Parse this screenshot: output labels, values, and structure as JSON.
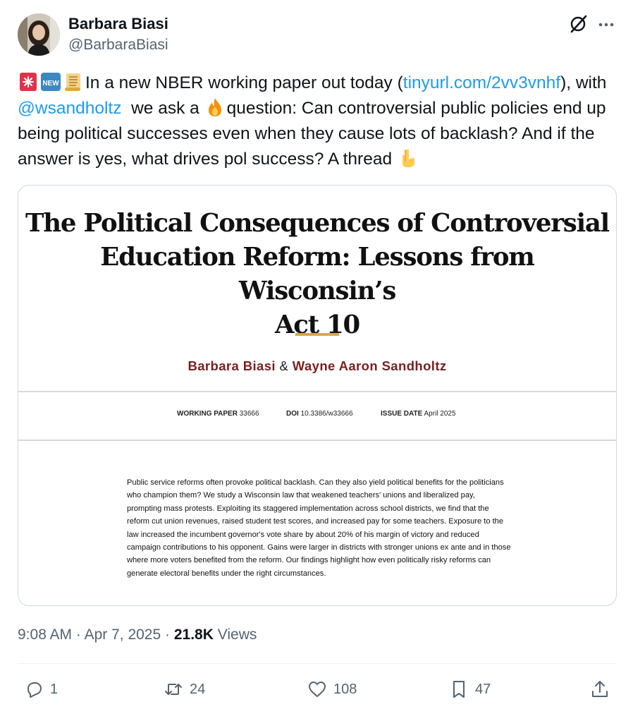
{
  "author": {
    "name": "Barbara Biasi",
    "handle": "@BarbaraBiasi"
  },
  "tweet": {
    "emojis": [
      "siren-emoji",
      "new-emoji",
      "scroll-emoji",
      "fire-emoji",
      "pointing-down-emoji"
    ],
    "part1": "In a new NBER working paper out today (",
    "link": "tinyurl.com/2vv3vnhf",
    "part2": "), with ",
    "mention": "@wsandholtz",
    "part3": "  we ask a ",
    "part4": "question: Can controversial public policies end up being political successes even when they cause lots of backlash? And if the answer is yes, what drives pol success? A thread "
  },
  "paper": {
    "title_line1": "The Political Consequences of Controversial",
    "title_line2": "Education Reform: Lessons from Wisconsin’s",
    "title_line3": "Act 10",
    "author1": "Barbara Biasi",
    "amp": "&",
    "author2": "Wayne Aaron Sandholtz",
    "wp_label": "WORKING PAPER",
    "wp_value": "33666",
    "doi_label": "DOI",
    "doi_value": "10.3386/w33666",
    "date_label": "ISSUE DATE",
    "date_value": "April 2025",
    "abstract": "Public service reforms often provoke political backlash. Can they also yield political benefits for the politicians who champion them? We study a Wisconsin law that weakened teachers' unions and liberalized pay, prompting mass protests. Exploiting its staggered implementation across school districts, we find that the reform cut union revenues, raised student test scores, and increased pay for some teachers. Exposure to the law increased the incumbent governor's vote share by about 20% of his margin of victory and reduced campaign contributions to his opponent. Gains were larger in districts with stronger unions ex ante and in those where more voters benefited from the reform. Our findings highlight how even politically risky reforms can generate electoral benefits under the right circumstances."
  },
  "meta": {
    "time": "9:08 AM",
    "sep1": " · ",
    "date": "Apr 7, 2025",
    "sep2": " · ",
    "views_count": "21.8K",
    "views_label": " Views"
  },
  "actions": {
    "replies": "1",
    "reposts": "24",
    "likes": "108",
    "bookmarks": "47"
  },
  "colors": {
    "link": "#1d9bf0",
    "secondary_text": "#536471",
    "author_red": "#7a1f1f",
    "gold_rule": "#d6a84b"
  }
}
